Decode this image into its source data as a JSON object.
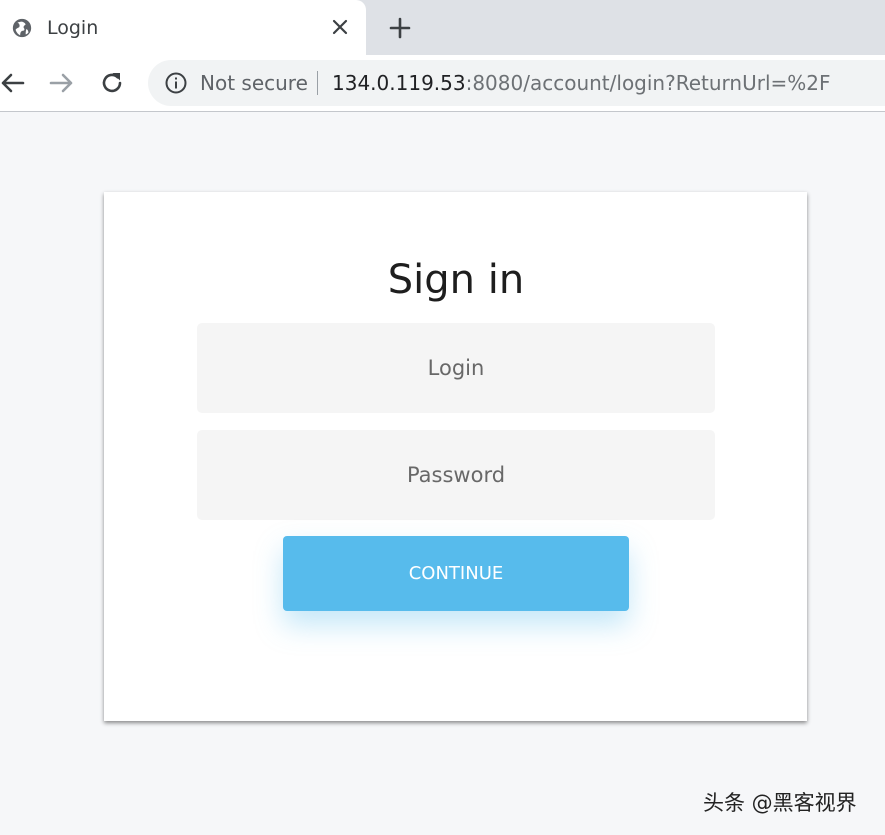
{
  "browser": {
    "tab": {
      "title": "Login",
      "icon": "globe-icon"
    },
    "nav": {
      "back": "arrow-left-icon",
      "forward": "arrow-right-icon",
      "reload": "reload-icon"
    },
    "address_bar": {
      "security_label": "Not secure",
      "url_host": "134.0.119.53",
      "url_rest": ":8080/account/login?ReturnUrl=%2F"
    }
  },
  "form": {
    "title": "Sign in",
    "login_placeholder": "Login",
    "password_placeholder": "Password",
    "submit_label": "CONTINUE"
  },
  "watermark": "头条 @黑客视界",
  "colors": {
    "accent": "#57bbec",
    "page_bg": "#f6f7f9",
    "field_bg": "#f5f5f5"
  }
}
